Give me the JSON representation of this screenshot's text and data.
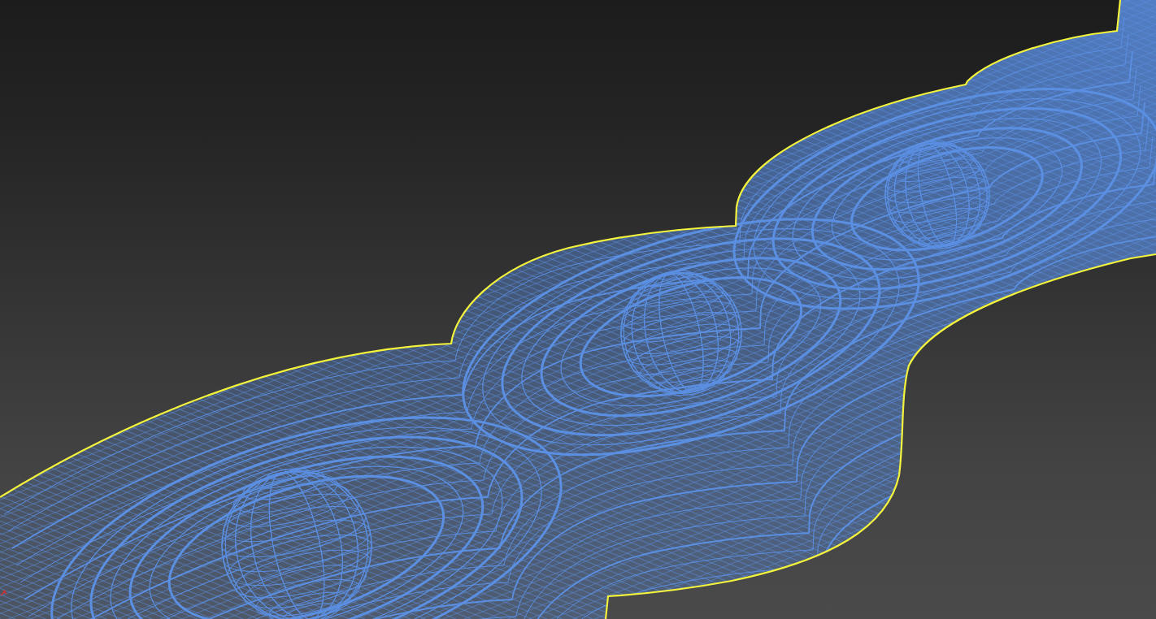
{
  "viewport": {
    "object": {
      "wireframe": true,
      "selected": true
    }
  }
}
